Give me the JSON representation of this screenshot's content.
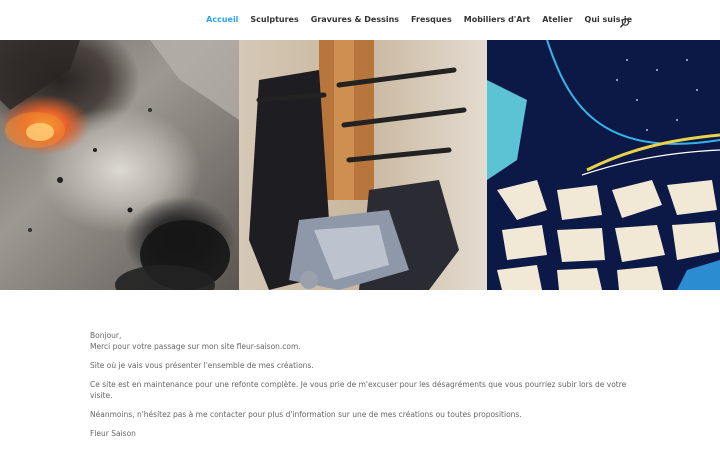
{
  "nav": {
    "items": [
      {
        "label": "Accueil",
        "active": true
      },
      {
        "label": "Sculptures",
        "active": false
      },
      {
        "label": "Gravures & Dessins",
        "active": false
      },
      {
        "label": "Fresques",
        "active": false
      },
      {
        "label": "Mobiliers d'Art",
        "active": false
      },
      {
        "label": "Atelier",
        "active": false
      },
      {
        "label": "Qui suis-je",
        "active": false
      }
    ],
    "search_icon": "search-icon",
    "active_color": "#2ea3f2"
  },
  "content": {
    "greeting": "Bonjour,",
    "line1": "Merci pour votre passage sur mon site fleur-saison.com.",
    "line2": "Site où je vais vous présenter l'ensemble de mes créations.",
    "line3": "Ce site est en maintenance pour une refonte complète. Je vous prie de m'excuser pour les désagréments que vous pourriez subir lors de votre visite.",
    "line4": "Néanmoins, n'hésitez pas à me contacter pour plus d'information sur une de mes créations ou toutes propositions.",
    "signature": "Fleur Saison"
  }
}
